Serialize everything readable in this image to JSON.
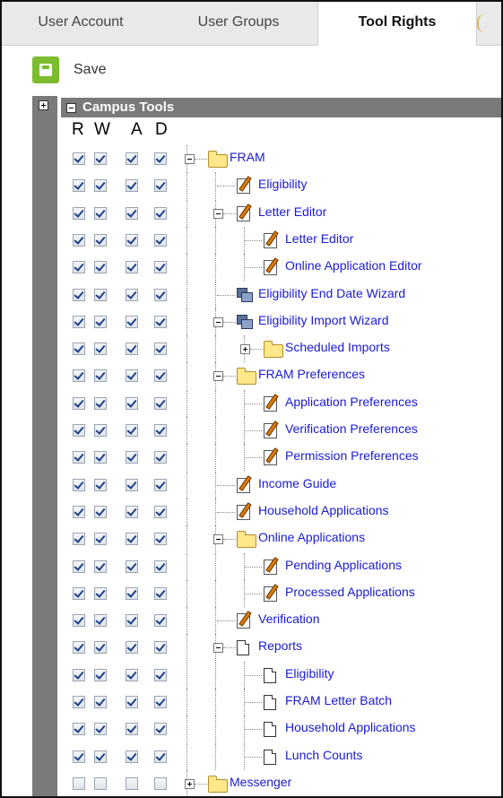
{
  "tabs": [
    {
      "label": "User Account",
      "active": false
    },
    {
      "label": "User Groups",
      "active": false
    },
    {
      "label": "Tool Rights",
      "active": true
    }
  ],
  "toolbar": {
    "save_label": "Save"
  },
  "tree": {
    "root_label": "Campus Tools",
    "columns": [
      "R",
      "W",
      "A",
      "D"
    ],
    "rows": [
      {
        "label": "FRAM",
        "icon": "folder-icon",
        "depth": 0,
        "expander": "minus",
        "checked": true
      },
      {
        "label": "Eligibility",
        "icon": "edit-doc-icon",
        "depth": 1,
        "expander": null,
        "checked": true
      },
      {
        "label": "Letter Editor",
        "icon": "edit-doc-icon",
        "depth": 1,
        "expander": "minus",
        "checked": true
      },
      {
        "label": "Letter Editor",
        "icon": "edit-doc-icon",
        "depth": 2,
        "expander": null,
        "checked": true
      },
      {
        "label": "Online Application Editor",
        "icon": "edit-doc-icon",
        "depth": 2,
        "expander": null,
        "checked": true
      },
      {
        "label": "Eligibility End Date Wizard",
        "icon": "wizard-icon",
        "depth": 1,
        "expander": null,
        "checked": true
      },
      {
        "label": "Eligibility Import Wizard",
        "icon": "wizard-icon",
        "depth": 1,
        "expander": "minus",
        "checked": true
      },
      {
        "label": "Scheduled Imports",
        "icon": "folder-icon",
        "depth": 2,
        "expander": "plus",
        "checked": true
      },
      {
        "label": "FRAM Preferences",
        "icon": "folder-icon",
        "depth": 1,
        "expander": "minus",
        "checked": true
      },
      {
        "label": "Application Preferences",
        "icon": "edit-doc-icon",
        "depth": 2,
        "expander": null,
        "checked": true
      },
      {
        "label": "Verification Preferences",
        "icon": "edit-doc-icon",
        "depth": 2,
        "expander": null,
        "checked": true
      },
      {
        "label": "Permission Preferences",
        "icon": "edit-doc-icon",
        "depth": 2,
        "expander": null,
        "checked": true
      },
      {
        "label": "Income Guide",
        "icon": "edit-doc-icon",
        "depth": 1,
        "expander": null,
        "checked": true
      },
      {
        "label": "Household Applications",
        "icon": "edit-doc-icon",
        "depth": 1,
        "expander": null,
        "checked": true
      },
      {
        "label": "Online Applications",
        "icon": "folder-icon",
        "depth": 1,
        "expander": "minus",
        "checked": true
      },
      {
        "label": "Pending Applications",
        "icon": "edit-doc-icon",
        "depth": 2,
        "expander": null,
        "checked": true
      },
      {
        "label": "Processed Applications",
        "icon": "edit-doc-icon",
        "depth": 2,
        "expander": null,
        "checked": true
      },
      {
        "label": "Verification",
        "icon": "edit-doc-icon",
        "depth": 1,
        "expander": null,
        "checked": true
      },
      {
        "label": "Reports",
        "icon": "document-icon",
        "depth": 1,
        "expander": "minus",
        "checked": true
      },
      {
        "label": "Eligibility",
        "icon": "document-icon",
        "depth": 2,
        "expander": null,
        "checked": true
      },
      {
        "label": "FRAM Letter Batch",
        "icon": "document-icon",
        "depth": 2,
        "expander": null,
        "checked": true
      },
      {
        "label": "Household Applications",
        "icon": "document-icon",
        "depth": 2,
        "expander": null,
        "checked": true
      },
      {
        "label": "Lunch Counts",
        "icon": "document-icon",
        "depth": 2,
        "expander": null,
        "checked": true
      },
      {
        "label": "Messenger",
        "icon": "folder-icon",
        "depth": 0,
        "expander": "plus",
        "checked": false
      }
    ]
  },
  "colors": {
    "save_green": "#7bbd2f",
    "rail_gray": "#7a7a7a",
    "link_blue": "#1a1ad6"
  }
}
